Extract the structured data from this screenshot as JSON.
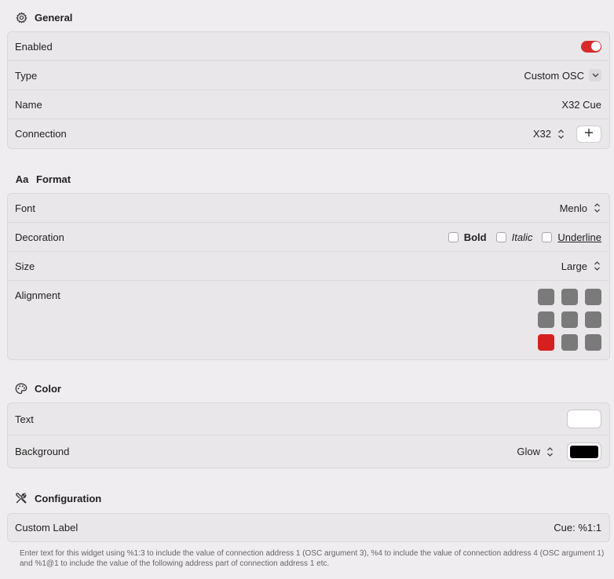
{
  "general": {
    "title": "General",
    "rows": {
      "enabled": {
        "label": "Enabled",
        "on": true
      },
      "type": {
        "label": "Type",
        "value": "Custom OSC"
      },
      "name": {
        "label": "Name",
        "value": "X32 Cue"
      },
      "connection": {
        "label": "Connection",
        "value": "X32"
      }
    }
  },
  "format": {
    "title": "Format",
    "icon_text": "Aa",
    "rows": {
      "font": {
        "label": "Font",
        "value": "Menlo"
      },
      "decoration": {
        "label": "Decoration",
        "bold": "Bold",
        "italic": "Italic",
        "underline": "Underline"
      },
      "size": {
        "label": "Size",
        "value": "Large"
      },
      "alignment": {
        "label": "Alignment",
        "selected": "bottom-left"
      }
    }
  },
  "color": {
    "title": "Color",
    "rows": {
      "text": {
        "label": "Text",
        "color": "#ffffff"
      },
      "background": {
        "label": "Background",
        "mode": "Glow",
        "color": "#000000"
      }
    }
  },
  "configuration": {
    "title": "Configuration",
    "rows": {
      "custom_label": {
        "label": "Custom Label",
        "value": "Cue: %1:1"
      }
    },
    "help": "Enter text for this widget using %1:3 to include the value of connection address 1 (OSC argument 3), %4 to include the value of connection address 4 (OSC argument 1) and %1@1 to include the value of the following address part of connection address 1 etc."
  },
  "colors": {
    "accent": "#d62b2b",
    "background": "#efedef"
  }
}
